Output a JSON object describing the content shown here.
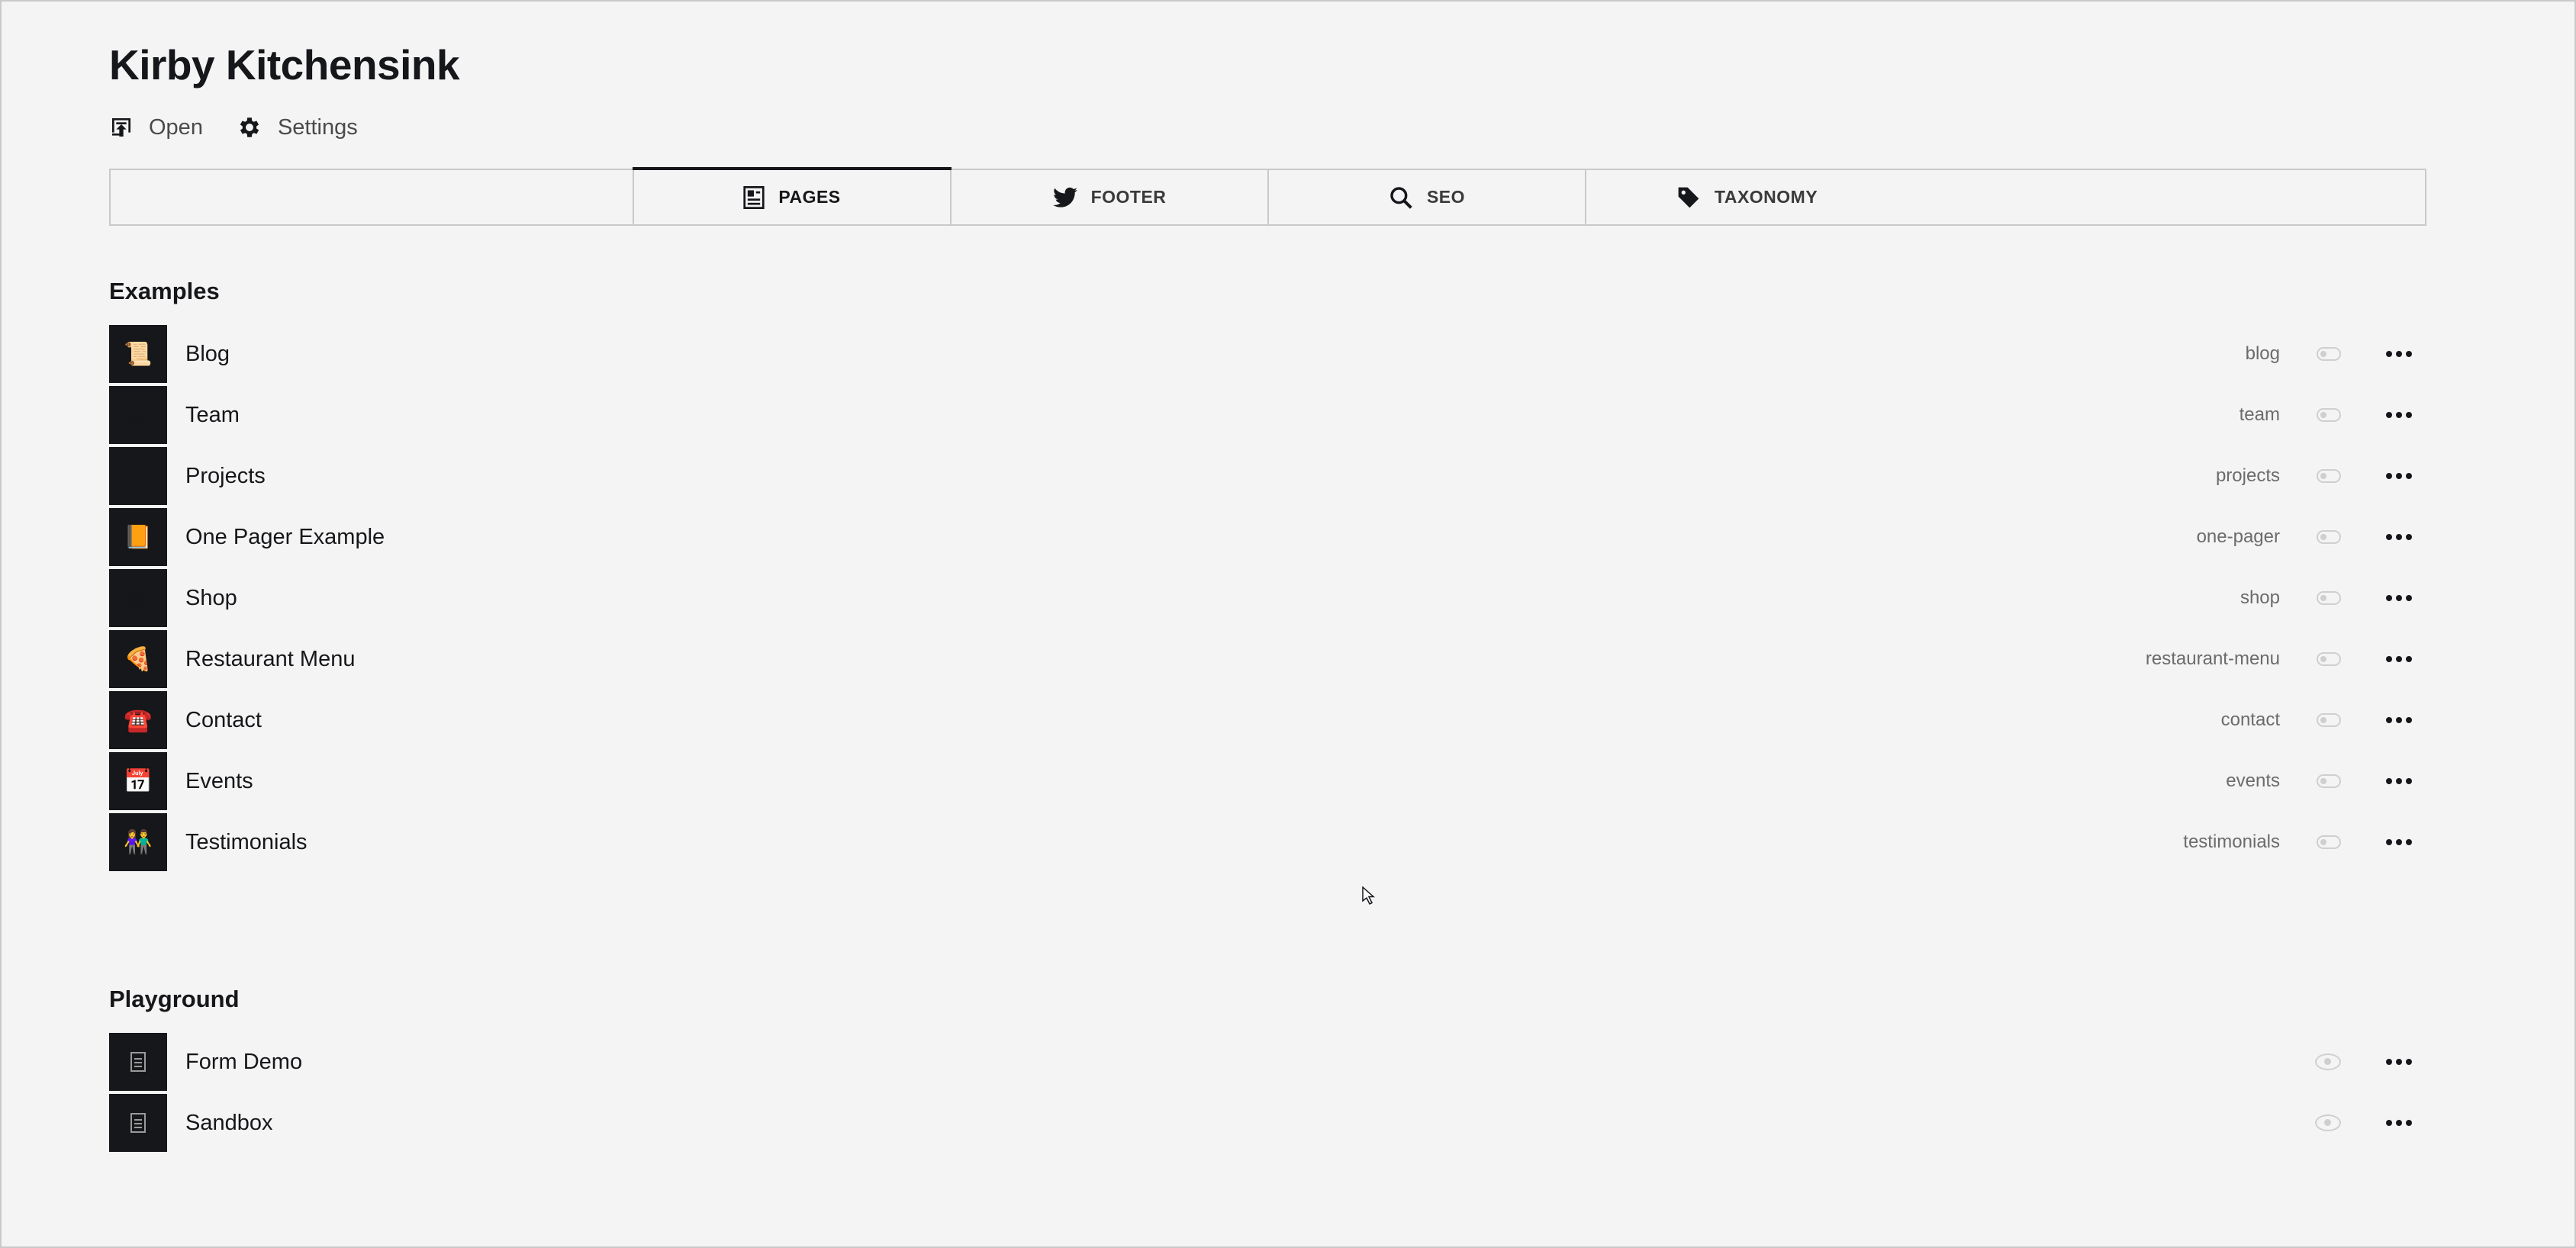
{
  "header": {
    "title": "Kirby Kitchensink",
    "open_label": "Open",
    "settings_label": "Settings"
  },
  "tabs": [
    {
      "label": "PAGES",
      "icon": "page-icon",
      "active": true
    },
    {
      "label": "FOOTER",
      "icon": "twitter-icon",
      "active": false
    },
    {
      "label": "SEO",
      "icon": "search-icon",
      "active": false
    },
    {
      "label": "TAXONOMY",
      "icon": "tag-icon",
      "active": false
    }
  ],
  "examples": {
    "title": "Examples",
    "items": [
      {
        "title": "Blog",
        "slug": "blog",
        "emoji": "📜"
      },
      {
        "title": "Team",
        "slug": "team",
        "emoji": "😺"
      },
      {
        "title": "Projects",
        "slug": "projects",
        "emoji": "🖼"
      },
      {
        "title": "One Pager Example",
        "slug": "one-pager",
        "emoji": "📙"
      },
      {
        "title": "Shop",
        "slug": "shop",
        "emoji": "🛍"
      },
      {
        "title": "Restaurant Menu",
        "slug": "restaurant-menu",
        "emoji": "🍕"
      },
      {
        "title": "Contact",
        "slug": "contact",
        "emoji": "☎️"
      },
      {
        "title": "Events",
        "slug": "events",
        "emoji": "📅"
      },
      {
        "title": "Testimonials",
        "slug": "testimonials",
        "emoji": "👫"
      }
    ]
  },
  "playground": {
    "title": "Playground",
    "items": [
      {
        "title": "Form Demo",
        "icon": "document-icon"
      },
      {
        "title": "Sandbox",
        "icon": "document-icon"
      }
    ]
  },
  "colors": {
    "background": "#f4f4f4",
    "text": "#16171a",
    "muted": "#6b6b6b",
    "border": "#c9c9c9"
  }
}
